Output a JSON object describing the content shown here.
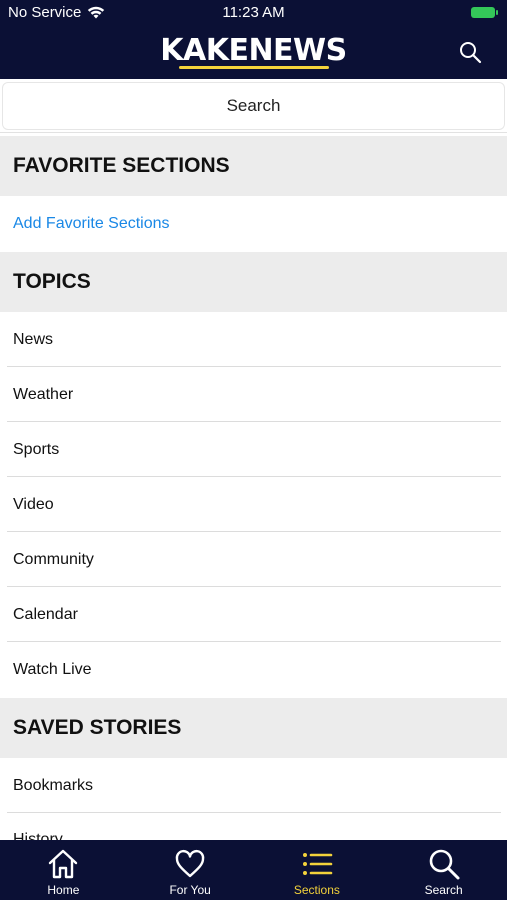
{
  "status": {
    "carrier": "No Service",
    "time": "11:23 AM"
  },
  "header": {
    "logo": "KAKENEWS"
  },
  "search": {
    "label": "Search"
  },
  "favorites": {
    "title": "FAVORITE SECTIONS",
    "add_label": "Add Favorite Sections"
  },
  "topics": {
    "title": "TOPICS",
    "items": [
      {
        "label": "News"
      },
      {
        "label": "Weather"
      },
      {
        "label": "Sports"
      },
      {
        "label": "Video"
      },
      {
        "label": "Community"
      },
      {
        "label": "Calendar"
      },
      {
        "label": "Watch Live"
      }
    ]
  },
  "saved": {
    "title": "SAVED STORIES",
    "items": [
      {
        "label": "Bookmarks"
      },
      {
        "label": "History"
      }
    ]
  },
  "tabs": [
    {
      "label": "Home",
      "icon": "home-icon"
    },
    {
      "label": "For You",
      "icon": "heart-icon"
    },
    {
      "label": "Sections",
      "icon": "list-icon"
    },
    {
      "label": "Search",
      "icon": "search-icon"
    }
  ],
  "colors": {
    "nav_bg": "#0b1035",
    "accent": "#f3d23b",
    "link": "#1a88e6",
    "section_bg": "#ececec"
  }
}
